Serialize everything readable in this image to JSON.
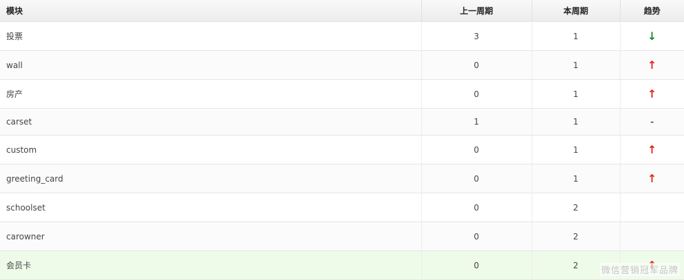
{
  "table": {
    "headers": [
      "模块",
      "上一周期",
      "本周期",
      "趋势"
    ],
    "rows": [
      {
        "module": "投票",
        "prev": "3",
        "curr": "1",
        "trend": "↓",
        "dir": "down"
      },
      {
        "module": "wall",
        "prev": "0",
        "curr": "1",
        "trend": "↑",
        "dir": "up"
      },
      {
        "module": "房产",
        "prev": "0",
        "curr": "1",
        "trend": "↑",
        "dir": "up"
      },
      {
        "module": "carset",
        "prev": "1",
        "curr": "1",
        "trend": "-",
        "dir": "flat"
      },
      {
        "module": "custom",
        "prev": "0",
        "curr": "1",
        "trend": "↑",
        "dir": "up"
      },
      {
        "module": "greeting_card",
        "prev": "0",
        "curr": "1",
        "trend": "↑",
        "dir": "up"
      },
      {
        "module": "schoolset",
        "prev": "0",
        "curr": "2",
        "trend": "",
        "dir": "none"
      },
      {
        "module": "carowner",
        "prev": "0",
        "curr": "2",
        "trend": "",
        "dir": "none"
      },
      {
        "module": "会员卡",
        "prev": "0",
        "curr": "2",
        "trend": "↑",
        "dir": "up"
      }
    ]
  },
  "watermark": "微信营销冠军品牌",
  "colors": {
    "up": "#e3261c",
    "down": "#1a8a2a",
    "highlight_row": "#eefbe8"
  }
}
